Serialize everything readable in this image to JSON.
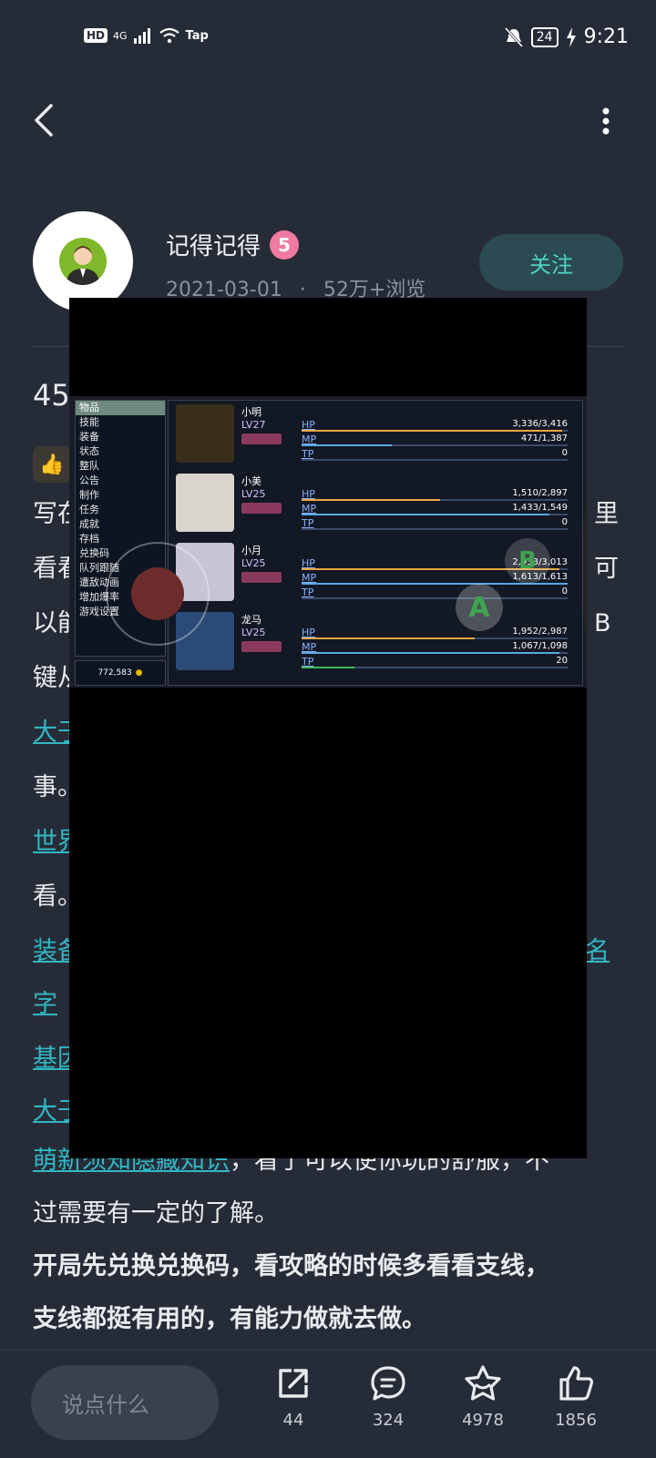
{
  "status_bar": {
    "hd": "HD",
    "network": "4G",
    "tap": "Tap",
    "battery": "24",
    "time": "9:21"
  },
  "author": {
    "name": "记得记得",
    "level": "5",
    "date": "2021-03-01",
    "separator": "·",
    "views": "52万+浏览",
    "follow_label": "关注"
  },
  "article": {
    "title_fragment": "45",
    "lines": [
      {
        "text": "写在",
        "right": "里"
      },
      {
        "text": "看看",
        "right": "可"
      },
      {
        "text": "以能",
        "right": "B"
      },
      {
        "text": "键从",
        "right": ""
      },
      {
        "text": "大于",
        "right": "",
        "link": true
      },
      {
        "text": "事。",
        "right": ""
      },
      {
        "text": "世界",
        "right": "",
        "link": true
      },
      {
        "text": "看。",
        "right": ""
      },
      {
        "text": "装备",
        "right": "名",
        "link": true
      },
      {
        "text": "字",
        "right": "",
        "link": true
      },
      {
        "text": "基因",
        "right": "",
        "link": true
      },
      {
        "text": "大于",
        "right": "",
        "link": true
      }
    ],
    "last_link": "萌新须知隐藏知识",
    "last_line_rest": "，看了可以使你玩的舒服，不",
    "line_a": "过需要有一定的了解。",
    "line_b": "开局先兑换兑换码，看攻略的时候多看看支线，",
    "line_c": "支线都挺有用的，有能力做就去做。"
  },
  "game": {
    "menu": [
      "物品",
      "技能",
      "装备",
      "状态",
      "整队",
      "公告",
      "制作",
      "任务",
      "成就",
      "存档",
      "兑换码",
      "队列跟随",
      "遭敌动画",
      "增加爆率",
      "游戏设置"
    ],
    "menu_selected": "物品",
    "gold": "772,583",
    "members": [
      {
        "name": "小明",
        "level": "LV27",
        "hp": "3,336/3,416",
        "mp": "471/1,387",
        "tp": "0",
        "hp_frac": 0.98,
        "mp_frac": 0.34,
        "tp_frac": 0
      },
      {
        "name": "小美",
        "level": "LV25",
        "hp": "1,510/2,897",
        "mp": "1,433/1,549",
        "tp": "0",
        "hp_frac": 0.52,
        "mp_frac": 0.93,
        "tp_frac": 0
      },
      {
        "name": "小月",
        "level": "LV25",
        "hp": "2,933/3,013",
        "mp": "1,613/1,613",
        "tp": "0",
        "hp_frac": 0.97,
        "mp_frac": 1.0,
        "tp_frac": 0
      },
      {
        "name": "龙马",
        "level": "LV25",
        "hp": "1,952/2,987",
        "mp": "1,067/1,098",
        "tp": "20",
        "hp_frac": 0.65,
        "mp_frac": 0.97,
        "tp_frac": 0.2
      }
    ],
    "stat_labels": {
      "hp": "HP",
      "mp": "MP",
      "tp": "TP"
    },
    "btn_a": "A",
    "btn_b": "B"
  },
  "bottom_bar": {
    "placeholder": "说点什么",
    "share_count": "44",
    "comment_count": "324",
    "favorite_count": "4978",
    "like_count": "1856"
  },
  "colors": {
    "background": "#262c37",
    "accent": "#31b7c4",
    "follow_text": "#4fd1c5",
    "level_badge": "#f07aa0"
  },
  "icons": [
    "back-icon",
    "more-icon",
    "thumb-icon",
    "share-icon",
    "comment-icon",
    "favorite-icon",
    "like-icon",
    "mute-icon",
    "wifi-icon",
    "signal-icon",
    "charging-icon"
  ]
}
